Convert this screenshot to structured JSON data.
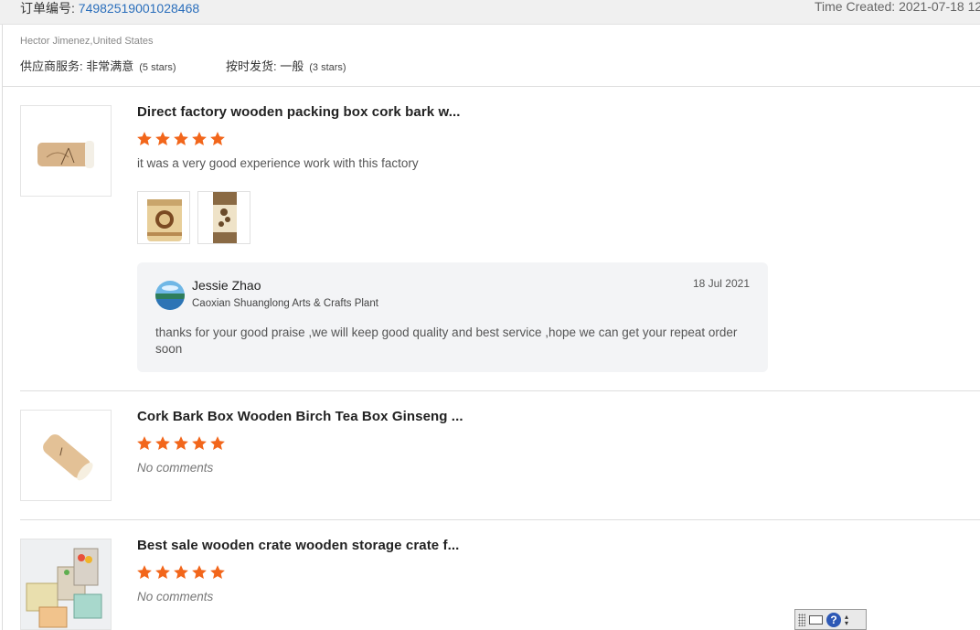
{
  "order": {
    "label": "订单编号:",
    "number": "74982519001028468",
    "time_created": "Time Created: 2021-07-18 12:"
  },
  "buyer": {
    "name_country": "Hector Jimenez,United States"
  },
  "ratings": {
    "service_label": "供应商服务: 非常满意",
    "service_note": "(5 stars)",
    "delivery_label": "按时发货: 一般",
    "delivery_note": "(3 stars)"
  },
  "products": [
    {
      "title": "Direct factory wooden packing box cork bark w...",
      "rating": 5,
      "comment": "it was a very good experience work with this factory"
    },
    {
      "title": "Cork Bark Box Wooden Birch Tea Box Ginseng ...",
      "rating": 5,
      "comment": "No comments"
    },
    {
      "title": "Best sale wooden crate wooden storage crate f...",
      "rating": 5,
      "comment": "No comments"
    }
  ],
  "reply": {
    "name": "Jessie Zhao",
    "company": "Caoxian Shuanglong Arts & Crafts Plant",
    "date": "18 Jul 2021",
    "text": "thanks for your good praise ,we will keep good quality and best service ,hope we can get your repeat order soon"
  },
  "ime_toolbar": {
    "help": "?"
  },
  "colors": {
    "star": "#f2661b",
    "link": "#2a6ebb",
    "reply_bg": "#f3f4f6"
  },
  "icons": [
    "star-icon",
    "keyboard-icon",
    "help-icon",
    "grip-icon"
  ]
}
